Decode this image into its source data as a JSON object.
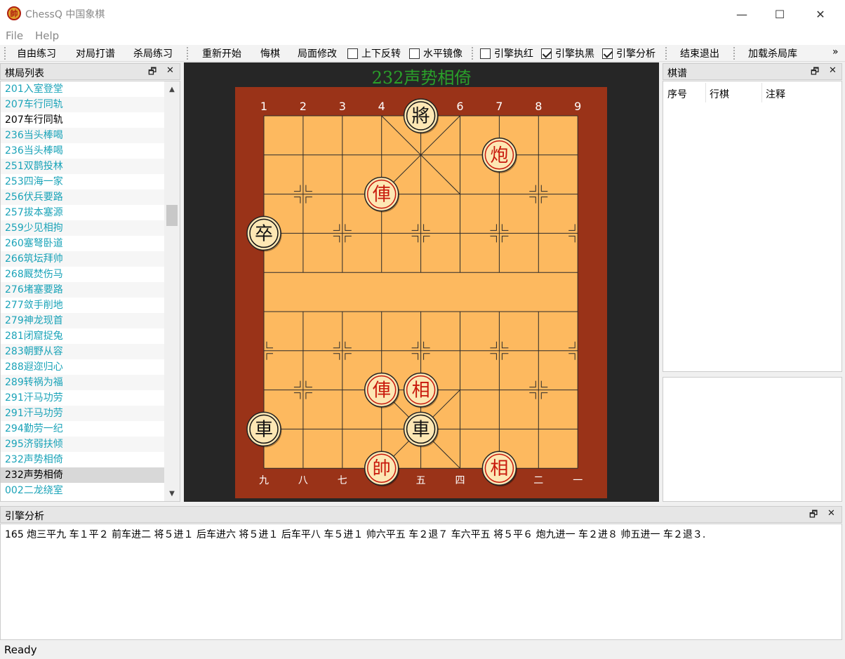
{
  "window": {
    "title": "ChessQ 中国象棋",
    "app_icon": "帥",
    "minimize": "—",
    "maximize": "☐",
    "close": "✕"
  },
  "menu": [
    "File",
    "Help"
  ],
  "toolbar": {
    "free_practice": "自由练习",
    "hit_book": "对局打谱",
    "kill_practice": "杀局练习",
    "restart": "重新开始",
    "undo": "悔棋",
    "edit_position": "局面修改",
    "flip_vertical": "上下反转",
    "mirror_horizontal": "水平镜像",
    "engine_red": "引擎执红",
    "engine_black": "引擎执黑",
    "engine_analyze": "引擎分析",
    "quit": "结束退出",
    "load_kill_library": "加载杀局库",
    "overflow": "»"
  },
  "checkboxes": {
    "flip_vertical": false,
    "mirror_horizontal": false,
    "engine_red": false,
    "engine_black": true,
    "engine_analyze": true
  },
  "game_list": {
    "title": "棋局列表",
    "items": [
      "201入室登堂",
      "207车行同轨",
      "207车行同轨",
      "236当头棒喝",
      "236当头棒喝",
      "251双鹊投林",
      "253四海一家",
      "256伏兵要路",
      "257拔本塞源",
      "259少见相拘",
      "260塞弩卧道",
      "266筑坛拜帅",
      "268厩焚伤马",
      "276堵塞要路",
      "277敛手削地",
      "279神龙现首",
      "281闭窟捉兔",
      "283朝野从容",
      "288遐迩归心",
      "289转祸为福",
      "291汗马功劳",
      "291汗马功劳",
      "294勤劳一纪",
      "295济弱扶倾",
      "232声势相倚",
      "232声势相倚",
      "002二龙绕室"
    ]
  },
  "board": {
    "title": "232声势相倚",
    "top_labels": [
      "1",
      "2",
      "3",
      "4",
      "5",
      "6",
      "7",
      "8",
      "9"
    ],
    "bottom_labels": [
      "九",
      "八",
      "七",
      "六",
      "五",
      "四",
      "三",
      "二",
      "一"
    ],
    "colors": {
      "frame": "#9a3318",
      "surface": "#fdb95f",
      "line": "#2b2b2b",
      "red": "#c8190c",
      "black": "#111111"
    },
    "pieces": [
      {
        "char": "將",
        "side": "black",
        "col": 4,
        "row": 0
      },
      {
        "char": "炮",
        "side": "red",
        "col": 6,
        "row": 1
      },
      {
        "char": "俥",
        "side": "red",
        "col": 3,
        "row": 2
      },
      {
        "char": "卒",
        "side": "black",
        "col": 0,
        "row": 3
      },
      {
        "char": "俥",
        "side": "red",
        "col": 3,
        "row": 7
      },
      {
        "char": "相",
        "side": "red",
        "col": 4,
        "row": 7
      },
      {
        "char": "車",
        "side": "black",
        "col": 0,
        "row": 8
      },
      {
        "char": "車",
        "side": "black",
        "col": 4,
        "row": 8
      },
      {
        "char": "帥",
        "side": "red",
        "col": 3,
        "row": 9
      },
      {
        "char": "相",
        "side": "red",
        "col": 6,
        "row": 9
      }
    ]
  },
  "notation": {
    "title": "棋谱",
    "columns": [
      "序号",
      "行棋",
      "注释"
    ]
  },
  "engine": {
    "title": "引擎分析",
    "output": "165 炮三平九 车１平２ 前车进二 将５进１ 后车进六 将５进１ 后车平八 车５进１ 帅六平五 车２退７ 车六平五 将５平６ 炮九进一 车２进８ 帅五进一 车２退３."
  },
  "status": "Ready"
}
